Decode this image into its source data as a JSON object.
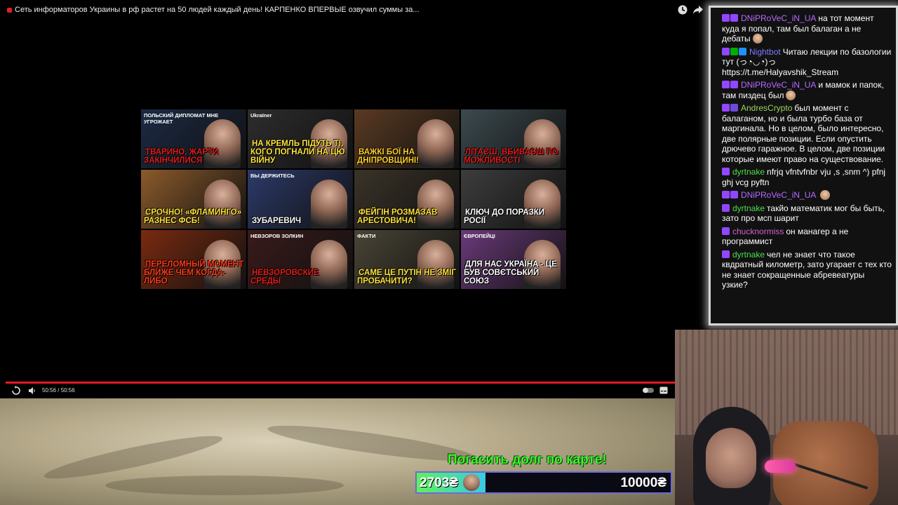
{
  "video": {
    "title": "Сеть информаторов Украины в рф растет на 50 людей каждый день! КАРПЕНКО ВПЕРВЫЕ озвучил суммы за...",
    "time": "50:56 / 50:56",
    "progress_fraction": 1.0,
    "accent_color": "#e31b23"
  },
  "endscreen": {
    "tiles": [
      {
        "headline": "Тварино, жарти закінчилися",
        "sub": "ПОЛЬСКИЙ ДИПЛОМАТ МНЕ УГРОЖАЕТ",
        "bg": "#1b2a44",
        "accent": "#e21c1c"
      },
      {
        "headline": "На Кремль підуть ті, кого погнали на цю війну",
        "sub": "Ukraїner",
        "bg": "#2d2d2d",
        "accent": "#ffe33a"
      },
      {
        "headline": "Важкі бої на Дніпровщині!",
        "sub": "",
        "bg": "#5a3a22",
        "accent": "#ffcf2a"
      },
      {
        "headline": "Літаєш, вбиваєш по можливості",
        "sub": "",
        "bg": "#3c4a4f",
        "accent": "#e21c1c"
      },
      {
        "headline": "Срочно! «Фламинго» разнес ФСБ!",
        "sub": "",
        "bg": "#8b5a2b",
        "accent": "#ffe33a"
      },
      {
        "headline": "Зубаревич",
        "sub": "ВЫ ДЕРЖИТЕСЬ",
        "bg": "#2c3a6a",
        "accent": "#ffffff"
      },
      {
        "headline": "Фейгін розмазав Арестовича!",
        "sub": "",
        "bg": "#3a3328",
        "accent": "#ffe33a"
      },
      {
        "headline": "Ключ до поразки Росії",
        "sub": "",
        "bg": "#3d3d3d",
        "accent": "#ffffff"
      },
      {
        "headline": "Переломный момент ближе чем когда-либо",
        "sub": "",
        "bg": "#7a2a10",
        "accent": "#ff3a1a"
      },
      {
        "headline": "Невзоровские среды",
        "sub": "НЕВЗОРОВ   ЗОЛКИН",
        "bg": "#3a1a1a",
        "accent": "#e21c1c"
      },
      {
        "headline": "Саме це Путін не зміг пробачити?",
        "sub": "ФАКТИ",
        "bg": "#4a4536",
        "accent": "#ffe33a"
      },
      {
        "headline": "Для нас Україна - це був совєтський союз",
        "sub": "ЄВРОПЕЙЦІ",
        "bg": "#6a3a7a",
        "accent": "#ffffff"
      }
    ]
  },
  "donation_goal": {
    "title": "Погасить долг по карте!",
    "current": "2703₴",
    "target": "10000₴",
    "progress_fraction": 0.2703
  },
  "chat": {
    "messages": [
      {
        "user": "DNiPRoVeC_iN_UA",
        "color": "#b46cff",
        "badges": [
          "#9147ff",
          "#9147ff"
        ],
        "text": "на тот момент куда я попал, там был балаган а не дебаты",
        "emote": true
      },
      {
        "user": "Nightbot",
        "color": "#7c7cff",
        "badges": [
          "#9147ff",
          "#00ad03",
          "#1e90ff"
        ],
        "text": "Читаю лекции по базологии тут (っ◔◡◔)っ https://t.me/Halyavshik_Stream",
        "emote": false
      },
      {
        "user": "DNiPRoVeC_iN_UA",
        "color": "#b46cff",
        "badges": [
          "#9147ff",
          "#9147ff"
        ],
        "text": "и мамок и папок, там пиздец был",
        "emote": true
      },
      {
        "user": "AndresCrypto",
        "color": "#9fd35a",
        "badges": [
          "#9147ff",
          "#6b4bd8"
        ],
        "text": "был момент с балаганом, но и была турбо база от маргинала. Но в целом, было интересно, две полярные позиции. Если опустить дрючево гаражное. В целом, две позиции которые имеют право на существование.",
        "emote": false
      },
      {
        "user": "dyrtnake",
        "color": "#4ede4e",
        "badges": [
          "#9147ff"
        ],
        "text": "nfrjq vfntvfnbr vju ,s ,snm ^) pfnj ghj vcg pyftn",
        "emote": false
      },
      {
        "user": "DNiPRoVeC_iN_UA",
        "color": "#b46cff",
        "badges": [
          "#9147ff",
          "#9147ff"
        ],
        "text": "",
        "emote": true
      },
      {
        "user": "dyrtnake",
        "color": "#4ede4e",
        "badges": [
          "#9147ff"
        ],
        "text": "такйо математик мог бы быть, зато про мсп шарит",
        "emote": false
      },
      {
        "user": "chucknormiss",
        "color": "#d060d0",
        "badges": [
          "#9147ff"
        ],
        "text": "он манагер а не программист",
        "emote": false
      },
      {
        "user": "dyrtnake",
        "color": "#4ede4e",
        "badges": [
          "#9147ff"
        ],
        "text": "чел не знает что такое квдратный километр, зато угарает с тех кто не знает сокращенные абревеатуры узкие?",
        "emote": false
      }
    ]
  }
}
